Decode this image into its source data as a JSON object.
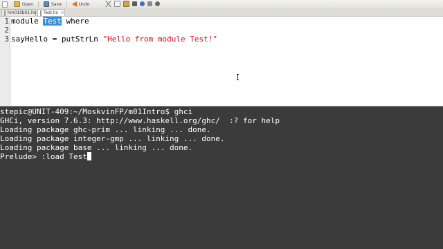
{
  "toolbar": {
    "new_label": "",
    "open_label": "Open",
    "save_label": "Save",
    "undo_label": "Undo"
  },
  "tabs": [
    {
      "label": "hm01lib01.hs",
      "active": false
    },
    {
      "label": "Test.hs",
      "active": true
    }
  ],
  "editor": {
    "lines": [
      {
        "number": "1",
        "pre": "module ",
        "selected": "Test",
        "post": " where"
      },
      {
        "number": "2",
        "text": ""
      },
      {
        "number": "3",
        "code": "sayHello = putStrLn ",
        "string": "\"Hello from module Test!\""
      }
    ]
  },
  "terminal": {
    "lines": [
      "stepic@UNIT-409:~/MoskvinFP/m01Intro$ ghci",
      "GHCi, version 7.6.3: http://www.haskell.org/ghc/  :? for help",
      "Loading package ghc-prim ... linking ... done.",
      "Loading package integer-gmp ... linking ... done.",
      "Loading package base ... linking ... done."
    ],
    "prompt": "Prelude> ",
    "input": ":load Test"
  },
  "colors": {
    "selection": "#3b8fd5",
    "string": "#c4161c",
    "terminal_bg": "#3b3b3b",
    "terminal_fg": "#ffffff"
  }
}
